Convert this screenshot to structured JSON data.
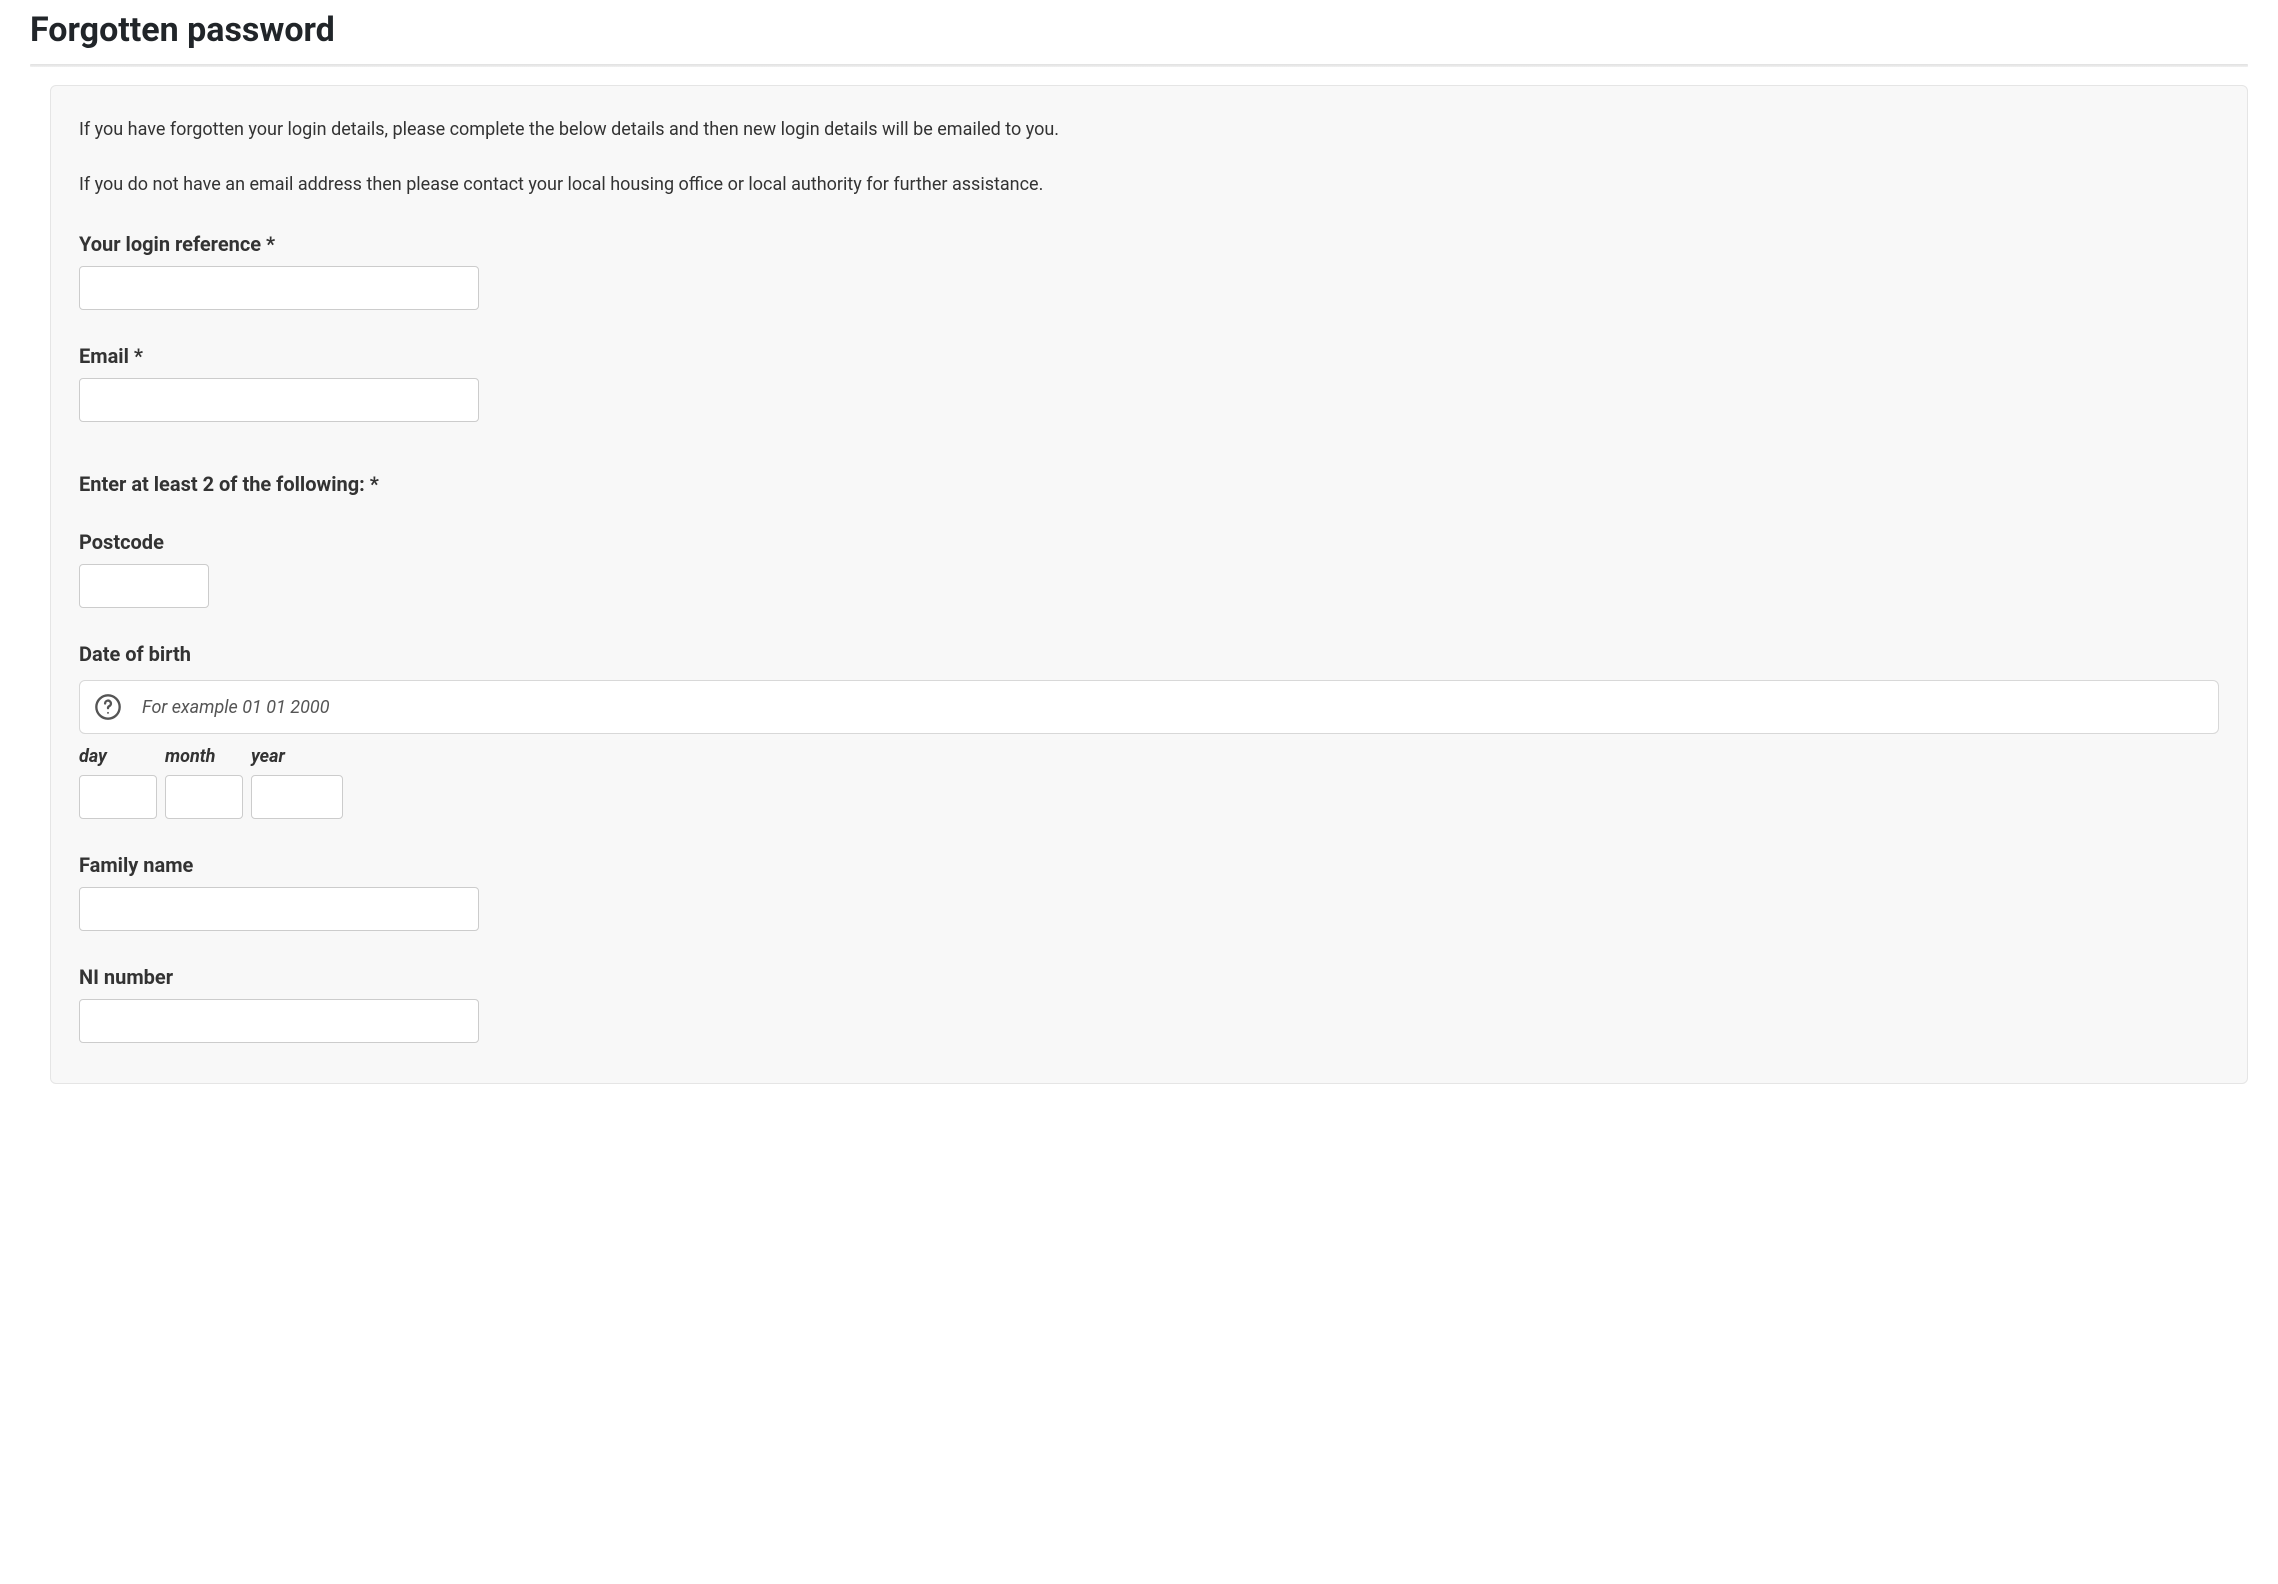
{
  "page": {
    "title": "Forgotten password",
    "instruction1": "If you have forgotten your login details, please complete the below details and then new login details will be emailed to you.",
    "instruction2": "If you do not have an email address then please contact your local housing office or local authority for further assistance."
  },
  "form": {
    "loginReference": {
      "label": "Your login reference *",
      "value": ""
    },
    "email": {
      "label": "Email *",
      "value": ""
    },
    "sectionLabel": "Enter at least 2 of the following: *",
    "postcode": {
      "label": "Postcode",
      "value": ""
    },
    "dob": {
      "label": "Date of birth",
      "hint": "For example 01 01 2000",
      "day": {
        "label": "day",
        "value": ""
      },
      "month": {
        "label": "month",
        "value": ""
      },
      "year": {
        "label": "year",
        "value": ""
      }
    },
    "familyName": {
      "label": "Family name",
      "value": ""
    },
    "niNumber": {
      "label": "NI number",
      "value": ""
    }
  }
}
